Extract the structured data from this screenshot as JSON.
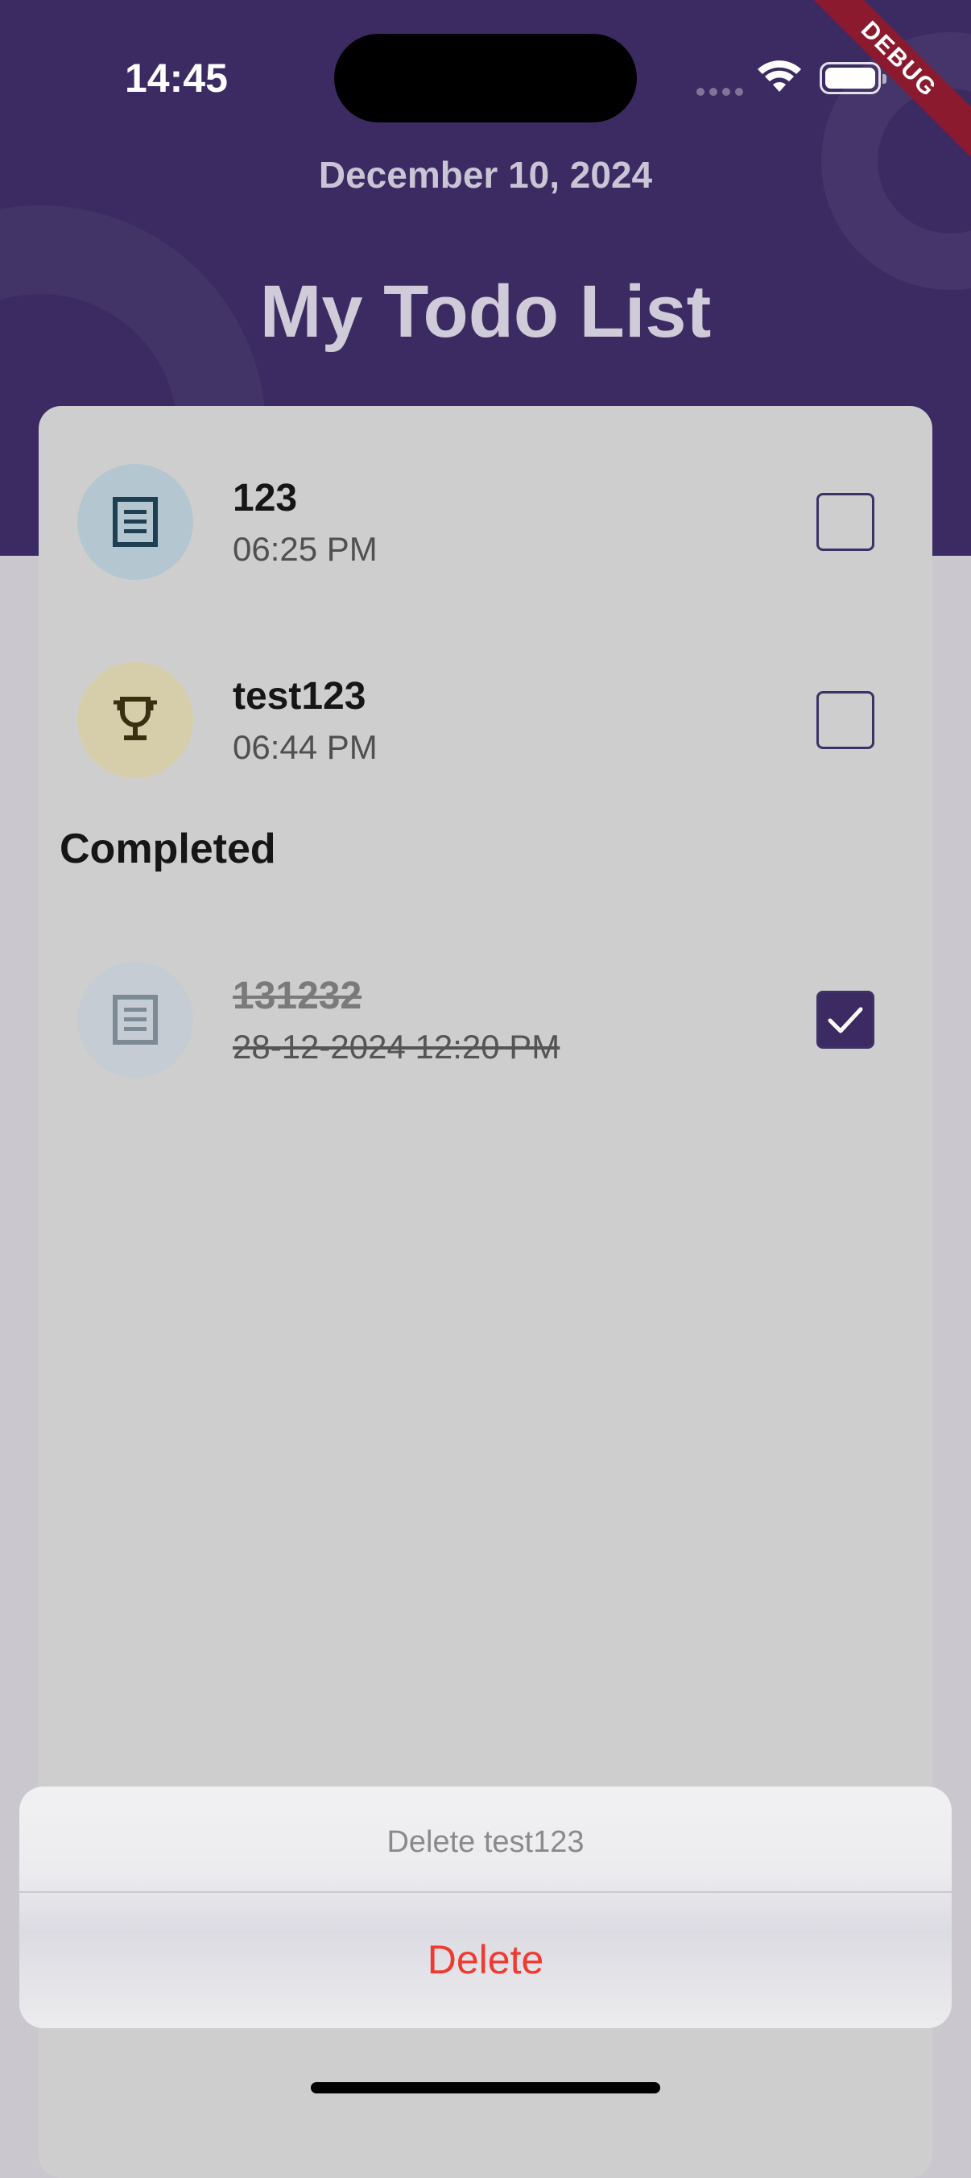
{
  "status_bar": {
    "time": "14:45"
  },
  "debug_banner": "DEBUG",
  "header": {
    "date": "December 10, 2024",
    "title": "My Todo List"
  },
  "todos": [
    {
      "title": "123",
      "time": "06:25 PM",
      "icon": "document-icon",
      "avatar_color": "#b4c6cf",
      "completed": false
    },
    {
      "title": "test123",
      "time": "06:44 PM",
      "icon": "trophy-icon",
      "avatar_color": "#d6ceaa",
      "completed": false
    }
  ],
  "completed_section": {
    "label": "Completed",
    "items": [
      {
        "title": "131232",
        "time": "28-12-2024 12:20 PM",
        "icon": "document-icon",
        "avatar_color": "#c6ccd3",
        "completed": true
      }
    ]
  },
  "action_sheet": {
    "title": "Delete test123",
    "action_label": "Delete",
    "action_color": "#ef3a30"
  },
  "colors": {
    "primary": "#3b2b62",
    "card": "#cecece",
    "background": "#cbc7cf"
  }
}
